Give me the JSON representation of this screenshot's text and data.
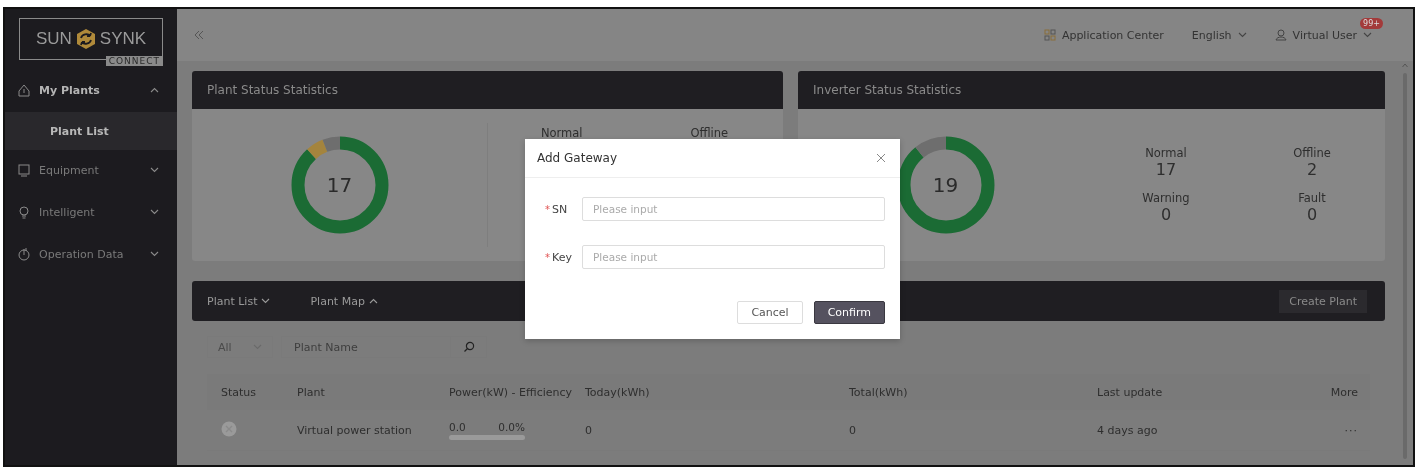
{
  "logo": {
    "brand_left": "SUN",
    "brand_right": "SYNK",
    "tagline": "CONNECT"
  },
  "sidebar": {
    "items": [
      {
        "label": "My Plants",
        "expanded": true,
        "children": [
          {
            "label": "Plant List",
            "selected": true
          }
        ]
      },
      {
        "label": "Equipment",
        "expanded": false
      },
      {
        "label": "Intelligent",
        "expanded": false
      },
      {
        "label": "Operation Data",
        "expanded": false
      }
    ]
  },
  "header": {
    "application_center": "Application Center",
    "language": "English",
    "user": "Virtual User",
    "notification_badge": "99+"
  },
  "plant_status": {
    "title": "Plant Status Statistics",
    "total": "17",
    "stats": [
      {
        "label": "Normal"
      },
      {
        "label": "Offline"
      }
    ]
  },
  "inverter_status": {
    "title": "Inverter Status Statistics",
    "total": "19",
    "stats": [
      {
        "label": "Normal",
        "value": "17"
      },
      {
        "label": "Offline",
        "value": "2"
      },
      {
        "label": "Warning",
        "value": "0"
      },
      {
        "label": "Fault",
        "value": "0"
      }
    ]
  },
  "plants": {
    "tabs": [
      {
        "label": "Plant List",
        "expanded": false
      },
      {
        "label": "Plant Map",
        "expanded": true
      }
    ],
    "create_button": "Create Plant",
    "filter": {
      "value": "All"
    },
    "search": {
      "placeholder": "Plant Name"
    },
    "table": {
      "columns": [
        "Status",
        "Plant",
        "Power(kW) - Efficiency",
        "Today(kWh)",
        "Total(kWh)",
        "Last update",
        "More"
      ],
      "rows": [
        {
          "offline": true,
          "plant": "Virtual power station",
          "power": "0.0",
          "efficiency": "0.0%",
          "level": 0,
          "today": "0",
          "total": "0",
          "last_update": "4 days ago",
          "more": "···"
        }
      ]
    }
  },
  "dialog": {
    "title": "Add Gateway",
    "fields": [
      {
        "required_mark": "*",
        "label": "SN",
        "placeholder": "Please input"
      },
      {
        "required_mark": "*",
        "label": "Key",
        "placeholder": "Please input"
      }
    ],
    "buttons": [
      {
        "label": "Cancel",
        "kind": "secondary"
      },
      {
        "label": "Confirm",
        "kind": "primary"
      }
    ]
  }
}
